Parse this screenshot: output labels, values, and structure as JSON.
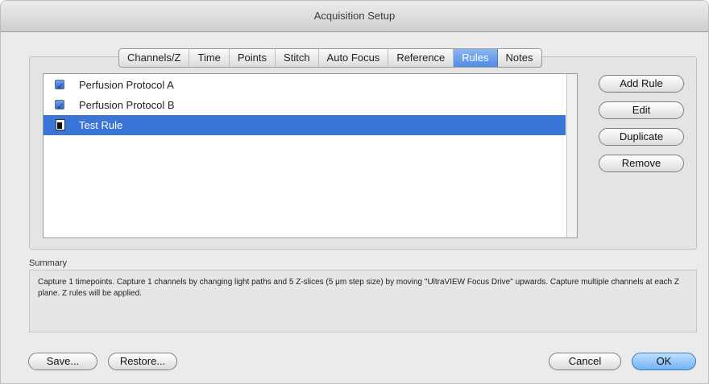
{
  "window": {
    "title": "Acquisition Setup"
  },
  "tabs": [
    {
      "label": "Channels/Z",
      "active": false
    },
    {
      "label": "Time",
      "active": false
    },
    {
      "label": "Points",
      "active": false
    },
    {
      "label": "Stitch",
      "active": false
    },
    {
      "label": "Auto Focus",
      "active": false
    },
    {
      "label": "Reference",
      "active": false
    },
    {
      "label": "Rules",
      "active": true
    },
    {
      "label": "Notes",
      "active": false
    }
  ],
  "rules": {
    "items": [
      {
        "label": "Perfusion Protocol A",
        "checked": true,
        "selected": false
      },
      {
        "label": "Perfusion Protocol B",
        "checked": true,
        "selected": false
      },
      {
        "label": "Test Rule",
        "checked": false,
        "selected": true
      }
    ],
    "buttons": {
      "add": "Add Rule",
      "edit": "Edit",
      "duplicate": "Duplicate",
      "remove": "Remove"
    }
  },
  "summary": {
    "label": "Summary",
    "text": "Capture 1 timepoints.  Capture 1 channels by changing light paths and 5 Z-slices (5 μm step size) by moving \"UltraVIEW Focus Drive\" upwards.  Capture multiple channels at each Z plane.  Z rules will be applied."
  },
  "footer": {
    "save": "Save...",
    "restore": "Restore...",
    "cancel": "Cancel",
    "ok": "OK"
  }
}
